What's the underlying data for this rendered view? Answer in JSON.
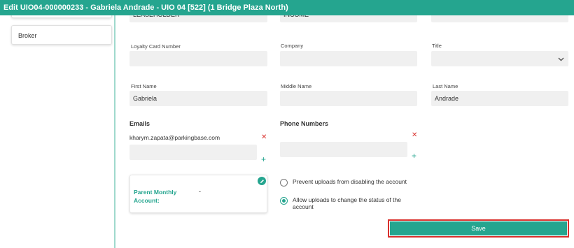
{
  "window": {
    "title": "Edit UIO04-000000233 - Gabriela Andrade - UIO 04 [522] (1 Bridge Plaza North)"
  },
  "sidebar": {
    "items": [
      {
        "label": "Broker"
      }
    ]
  },
  "form": {
    "row0": {
      "type_value": "LEASEHOLDER",
      "income_value": "INCOME",
      "third_value": ""
    },
    "loyalty_card": {
      "label": "Loyalty Card Number",
      "value": ""
    },
    "company": {
      "label": "Company",
      "value": ""
    },
    "title": {
      "label": "Title",
      "value": ""
    },
    "first_name": {
      "label": "First Name",
      "value": "Gabriela"
    },
    "middle_name": {
      "label": "Middle Name",
      "value": ""
    },
    "last_name": {
      "label": "Last Name",
      "value": "Andrade"
    },
    "emails": {
      "label": "Emails",
      "items": [
        "kharym.zapata@parkingbase.com"
      ],
      "new_value": ""
    },
    "phones": {
      "label": "Phone Numbers",
      "new_value": ""
    },
    "parent_account": {
      "label": "Parent Monthly Account:",
      "value": "-"
    },
    "options": {
      "prevent_uploads": {
        "label": "Prevent uploads from disabling the account",
        "checked": false
      },
      "allow_uploads": {
        "label": "Allow uploads to change the status of the account",
        "checked": true
      }
    },
    "save_label": "Save"
  },
  "colors": {
    "accent": "#25a58f",
    "danger": "#d9302c",
    "input_bg": "#f0f0f0"
  },
  "icons": {
    "remove": "close-icon",
    "add": "plus-icon",
    "edit": "pencil-icon",
    "dropdown": "chevron-down-icon"
  }
}
